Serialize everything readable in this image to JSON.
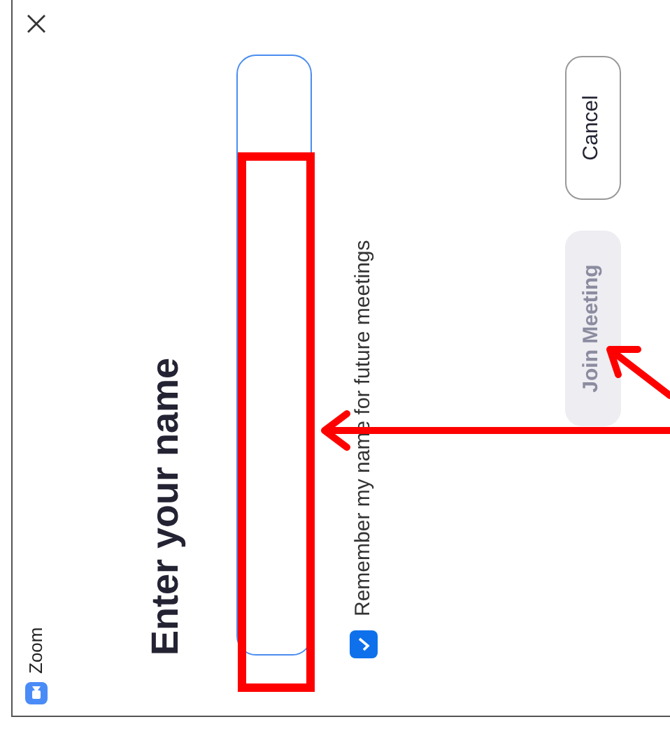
{
  "window": {
    "title": "Zoom"
  },
  "heading": "Enter your name",
  "remember": {
    "label": "Remember my name for future meetings",
    "checked": true
  },
  "buttons": [
    {
      "label": "Join Meeting",
      "disabled": true
    },
    {
      "label": "Cancel",
      "disabled": false
    }
  ]
}
